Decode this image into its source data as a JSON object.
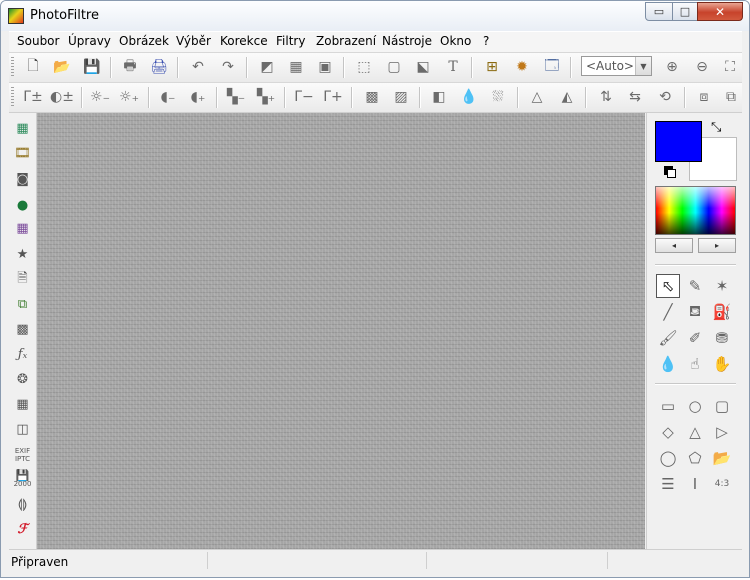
{
  "window": {
    "title": "PhotoFiltre"
  },
  "window_controls": {
    "minimize": "▭",
    "maximize": "□",
    "close": "✕"
  },
  "menu": [
    "Soubor",
    "Úpravy",
    "Obrázek",
    "Výběr",
    "Korekce",
    "Filtry",
    "Zobrazení",
    "Nástroje",
    "Okno",
    "?"
  ],
  "toolbar": {
    "zoom_value": "<Auto>",
    "text_tool_glyph": "T"
  },
  "toolbar2": {
    "gamma_minus": "Γ−",
    "gamma_plus": "Γ+"
  },
  "left_panel": {
    "exif_label": "EXIF\nIPTC",
    "save_label": "2000"
  },
  "colors": {
    "foreground": "#0000ff",
    "background": "#ffffff"
  },
  "color_arrows": {
    "prev": "◂",
    "next": "▸"
  },
  "shapes": {
    "ratio_label": "4:3"
  },
  "status": {
    "text": "Připraven"
  }
}
